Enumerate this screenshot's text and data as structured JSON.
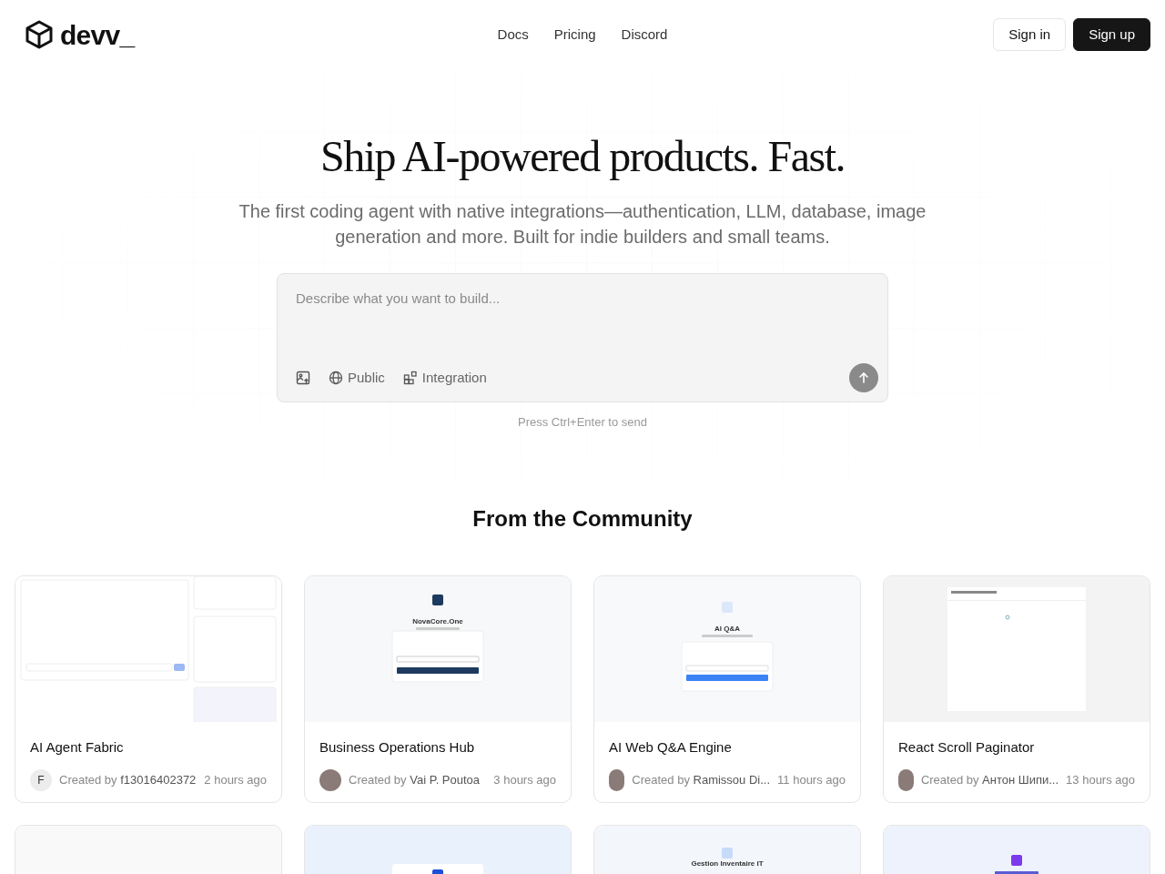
{
  "header": {
    "logo_text": "devv_",
    "nav": [
      "Docs",
      "Pricing",
      "Discord"
    ],
    "buttons": [
      {
        "label": "Sign in",
        "kind": "outline"
      },
      {
        "label": "Sign up",
        "kind": "solid"
      }
    ]
  },
  "hero": {
    "title": "Ship AI-powered products. Fast.",
    "subtitle": "The first coding agent with native integrations—authentication, LLM, database, image generation and more. Built for indie builders and small teams.",
    "prompt": {
      "placeholder": "Describe what you want to build...",
      "tools": [
        {
          "kind": "image"
        },
        {
          "kind": "globe",
          "label": "Public"
        },
        {
          "kind": "blocks",
          "label": "Integration"
        }
      ],
      "hint": "Press Ctrl+Enter to send"
    }
  },
  "community": {
    "title": "From the Community",
    "cards": [
      {
        "preview": {
          "kind": "dashboard"
        },
        "name": "AI Agent Fabric",
        "author_prefix": "Created by",
        "author": "f13016402372",
        "avatar": {
          "kind": "letter",
          "letter": "F"
        },
        "time": "2 hours ago"
      },
      {
        "preview": {
          "kind": "login_dark",
          "title": "NovaCore.One"
        },
        "name": "Business Operations Hub",
        "author_prefix": "Created by",
        "author": "Vai P. Poutoa",
        "avatar": {
          "kind": "photo"
        },
        "time": "3 hours ago"
      },
      {
        "preview": {
          "kind": "login_blue",
          "title": "AI Q&A"
        },
        "name": "AI Web Q&A Engine",
        "author_prefix": "Created by",
        "author": "Ramissou Di...",
        "avatar": {
          "kind": "photo"
        },
        "time": "11 hours ago"
      },
      {
        "preview": {
          "kind": "panel"
        },
        "name": "React Scroll Paginator",
        "author_prefix": "Created by",
        "author": "Антон Шипи...",
        "avatar": {
          "kind": "photo"
        },
        "time": "13 hours ago"
      },
      {
        "preview": {
          "kind": "blank"
        }
      },
      {
        "preview": {
          "kind": "icon_blue"
        }
      },
      {
        "preview": {
          "kind": "icon_light",
          "title": "Gestion Inventaire IT"
        }
      },
      {
        "preview": {
          "kind": "icon_violet"
        }
      }
    ]
  }
}
